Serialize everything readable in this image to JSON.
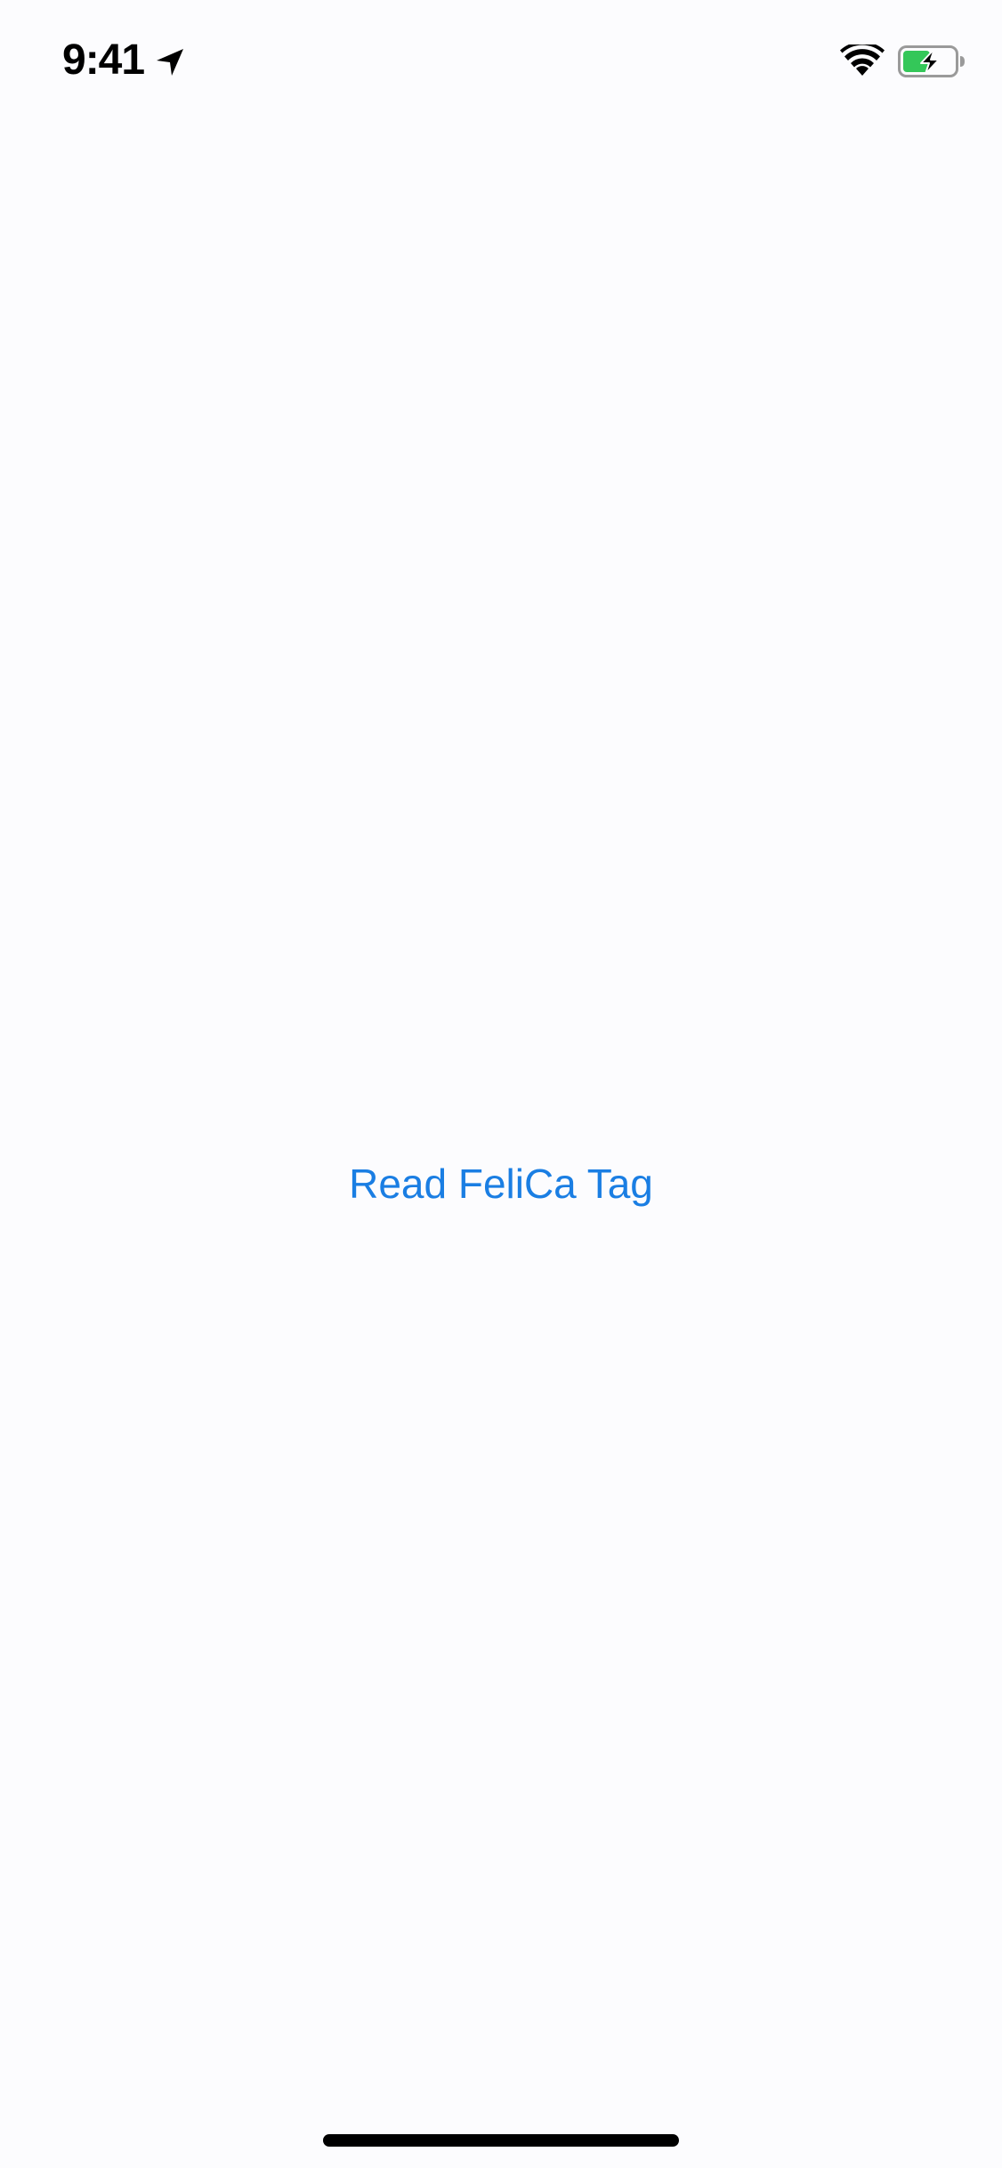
{
  "status_bar": {
    "time": "9:41",
    "location_icon": "location-arrow-icon",
    "wifi_icon": "wifi-icon",
    "battery_icon": "battery-charging-icon",
    "battery_color": "#34c759"
  },
  "main": {
    "read_button_label": "Read FeliCa Tag",
    "accent_color": "#1a7ee3"
  },
  "home_indicator": {
    "icon": "home-indicator"
  }
}
